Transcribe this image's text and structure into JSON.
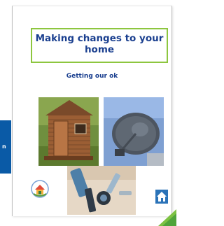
{
  "document": {
    "title": "Making changes to your home",
    "subtitle": "Getting our ok"
  },
  "images": {
    "shed": "garden shed photo",
    "satellite": "satellite dish photo",
    "tools": "DIY tools photo"
  },
  "colors": {
    "accent_green": "#8dc63f",
    "text_blue": "#1a3f8f",
    "tab_blue": "#0a5aa6"
  }
}
